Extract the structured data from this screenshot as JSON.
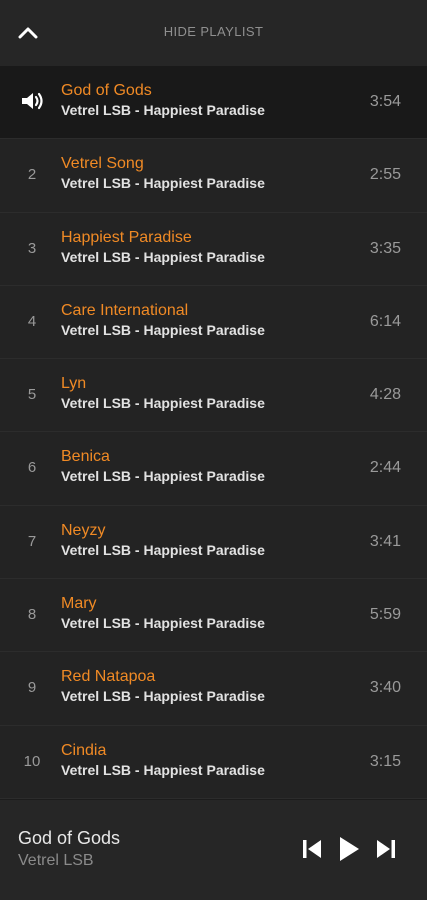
{
  "header": {
    "hide_label": "HIDE PLAYLIST",
    "collapse_icon": "chevron-up-icon"
  },
  "playlist": {
    "tracks": [
      {
        "index": "1",
        "title": "God of Gods",
        "artist": "Vetrel LSB - Happiest Paradise",
        "duration": "3:54",
        "playing": true
      },
      {
        "index": "2",
        "title": "Vetrel Song",
        "artist": "Vetrel LSB - Happiest Paradise",
        "duration": "2:55",
        "playing": false
      },
      {
        "index": "3",
        "title": "Happiest Paradise",
        "artist": "Vetrel LSB - Happiest Paradise",
        "duration": "3:35",
        "playing": false
      },
      {
        "index": "4",
        "title": "Care International",
        "artist": "Vetrel LSB - Happiest Paradise",
        "duration": "6:14",
        "playing": false
      },
      {
        "index": "5",
        "title": "Lyn",
        "artist": "Vetrel LSB - Happiest Paradise",
        "duration": "4:28",
        "playing": false
      },
      {
        "index": "6",
        "title": "Benica",
        "artist": "Vetrel LSB - Happiest Paradise",
        "duration": "2:44",
        "playing": false
      },
      {
        "index": "7",
        "title": "Neyzy",
        "artist": "Vetrel LSB - Happiest Paradise",
        "duration": "3:41",
        "playing": false
      },
      {
        "index": "8",
        "title": "Mary",
        "artist": "Vetrel LSB - Happiest Paradise",
        "duration": "5:59",
        "playing": false
      },
      {
        "index": "9",
        "title": "Red Natapoa",
        "artist": "Vetrel LSB - Happiest Paradise",
        "duration": "3:40",
        "playing": false
      },
      {
        "index": "10",
        "title": "Cindia",
        "artist": "Vetrel LSB - Happiest Paradise",
        "duration": "3:15",
        "playing": false
      }
    ]
  },
  "player": {
    "now_title": "God of Gods",
    "now_artist": "Vetrel LSB",
    "prev_icon": "skip-previous-icon",
    "play_icon": "play-icon",
    "next_icon": "skip-next-icon"
  },
  "colors": {
    "accent": "#f08a25",
    "background": "#232323",
    "active_row": "#191919"
  }
}
